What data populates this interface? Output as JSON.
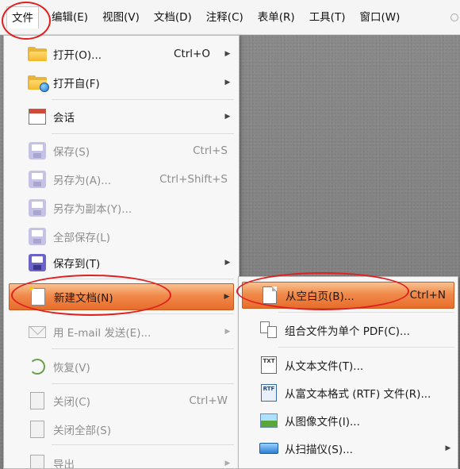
{
  "menubar": {
    "items": [
      {
        "label": "文件",
        "active": true
      },
      {
        "label": "编辑(E)"
      },
      {
        "label": "视图(V)"
      },
      {
        "label": "文档(D)"
      },
      {
        "label": "注释(C)"
      },
      {
        "label": "表单(R)"
      },
      {
        "label": "工具(T)"
      },
      {
        "label": "窗口(W)"
      }
    ]
  },
  "file_menu": {
    "items": [
      {
        "label": "打开(O)...",
        "shortcut": "Ctrl+O",
        "submenu": true,
        "icon": "folder-open-icon",
        "enabled": true
      },
      {
        "label": "打开自(F)",
        "shortcut": "",
        "submenu": true,
        "icon": "folder-web-icon",
        "enabled": true
      },
      {
        "label": "会话",
        "shortcut": "",
        "submenu": true,
        "icon": "calendar-icon",
        "enabled": true
      },
      {
        "label": "保存(S)",
        "shortcut": "Ctrl+S",
        "submenu": false,
        "icon": "save-icon",
        "enabled": false
      },
      {
        "label": "另存为(A)...",
        "shortcut": "Ctrl+Shift+S",
        "submenu": false,
        "icon": "save-as-icon",
        "enabled": false
      },
      {
        "label": "另存为副本(Y)...",
        "shortcut": "",
        "submenu": false,
        "icon": "save-copy-icon",
        "enabled": false
      },
      {
        "label": "全部保存(L)",
        "shortcut": "",
        "submenu": false,
        "icon": "save-all-icon",
        "enabled": false
      },
      {
        "label": "保存到(T)",
        "shortcut": "",
        "submenu": true,
        "icon": "save-to-icon",
        "enabled": true
      },
      {
        "label": "新建文档(N)",
        "shortcut": "",
        "submenu": true,
        "icon": "new-document-icon",
        "enabled": true,
        "highlighted": true
      },
      {
        "label": "用 E-mail 发送(E)...",
        "shortcut": "",
        "submenu": true,
        "icon": "email-icon",
        "enabled": false
      },
      {
        "label": "恢复(V)",
        "shortcut": "",
        "submenu": false,
        "icon": "restore-icon",
        "enabled": false
      },
      {
        "label": "关闭(C)",
        "shortcut": "Ctrl+W",
        "submenu": false,
        "icon": "close-document-icon",
        "enabled": false
      },
      {
        "label": "关闭全部(S)",
        "shortcut": "",
        "submenu": false,
        "icon": "close-all-icon",
        "enabled": false
      },
      {
        "label": "导出",
        "shortcut": "",
        "submenu": true,
        "icon": "export-icon",
        "enabled": false
      }
    ]
  },
  "new_document_submenu": {
    "items": [
      {
        "label": "从空白页(B)...",
        "shortcut": "Ctrl+N",
        "submenu": false,
        "icon": "blank-page-icon",
        "highlighted": true
      },
      {
        "label": "组合文件为单个 PDF(C)...",
        "shortcut": "",
        "submenu": false,
        "icon": "combine-files-icon"
      },
      {
        "label": "从文本文件(T)...",
        "shortcut": "",
        "submenu": false,
        "icon": "text-file-icon",
        "icon_text": "TXT"
      },
      {
        "label": "从富文本格式 (RTF) 文件(R)...",
        "shortcut": "",
        "submenu": false,
        "icon": "rtf-file-icon",
        "icon_text": "RTF"
      },
      {
        "label": "从图像文件(I)...",
        "shortcut": "",
        "submenu": false,
        "icon": "image-file-icon"
      },
      {
        "label": "从扫描仪(S)...",
        "shortcut": "",
        "submenu": true,
        "icon": "scanner-icon"
      }
    ]
  },
  "colors": {
    "highlight": "#e86d2c",
    "annotation": "#e02020",
    "disabled_text": "#8e8e8e"
  }
}
